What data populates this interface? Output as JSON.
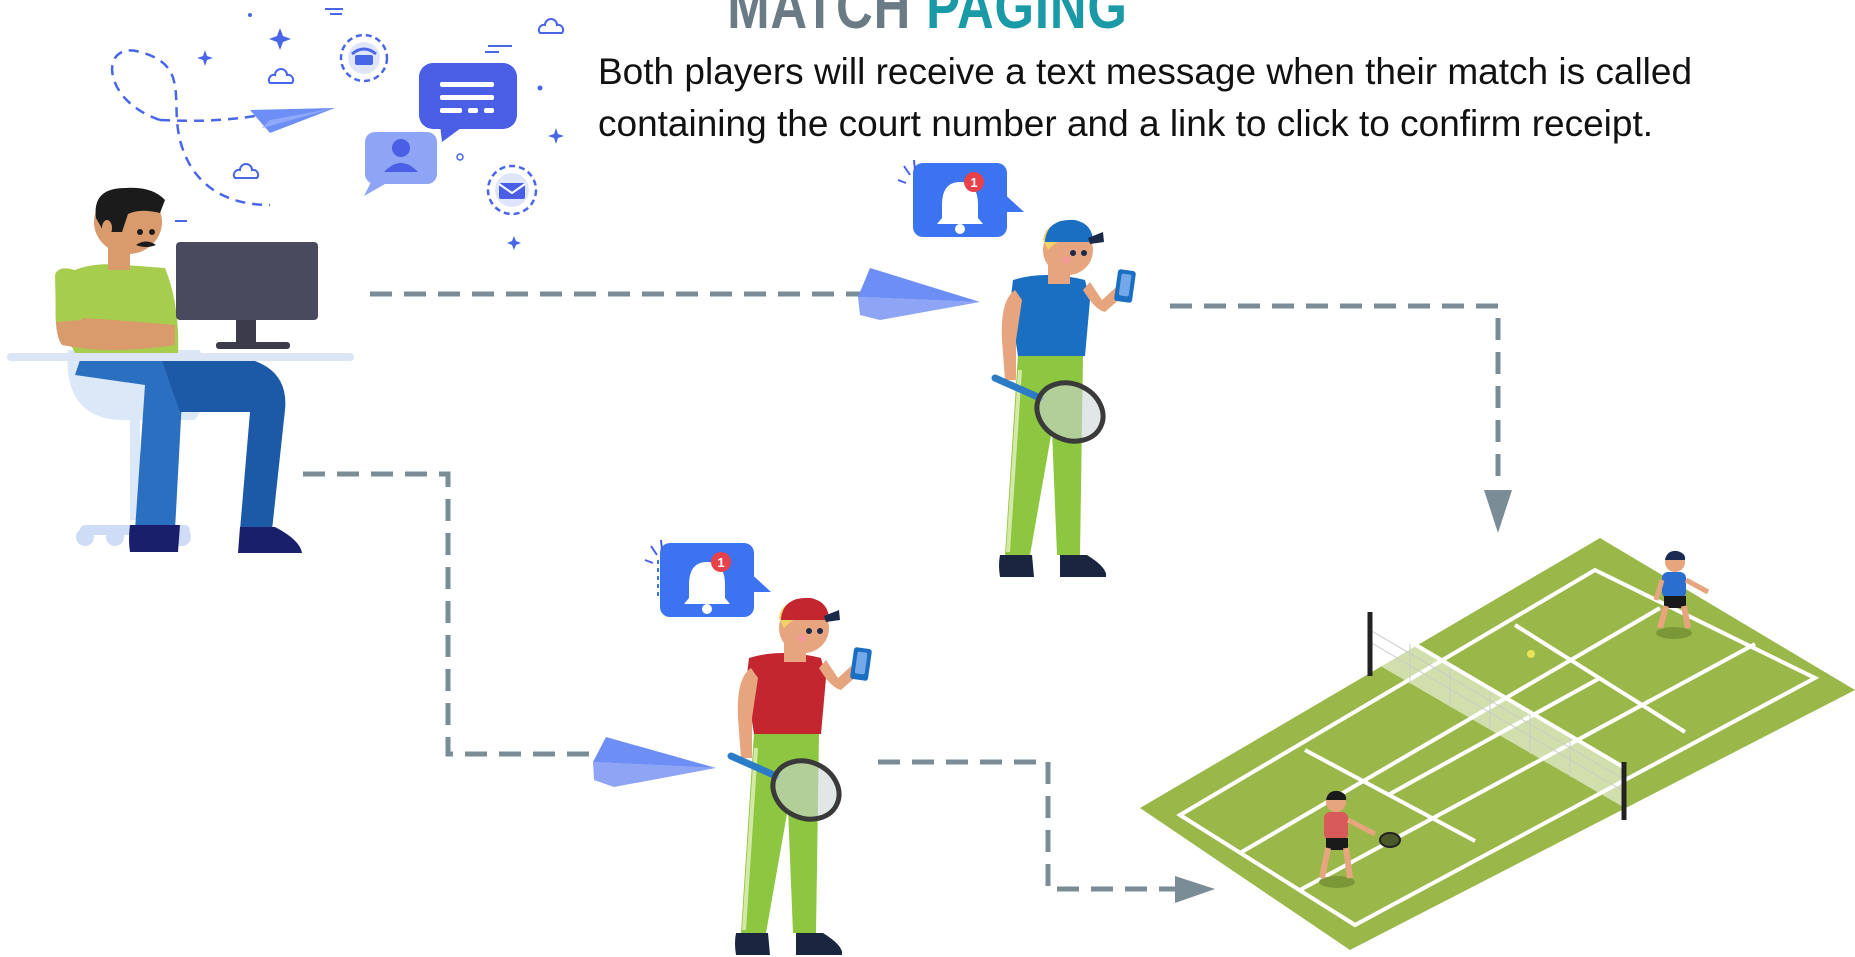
{
  "header": {
    "title_word1": "MATCH",
    "title_word2": "PAGING"
  },
  "description": "Both players will receive a text message when their match is called containing the court number and a link to click to confirm receipt.",
  "notifications": [
    {
      "badge": "1"
    },
    {
      "badge": "1"
    }
  ],
  "colors": {
    "title_gray": "#6b7b86",
    "title_teal": "#1a9aa6",
    "connector": "#7a8c96",
    "court_green": "#9ab84a",
    "notify_blue": "#3b73f0",
    "badge_red": "#e8414a"
  }
}
